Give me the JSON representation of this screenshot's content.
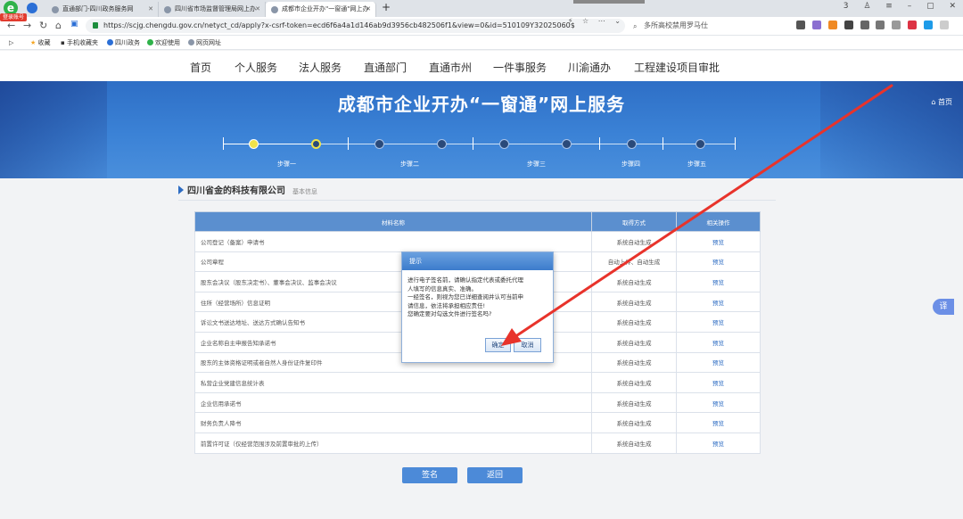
{
  "browser": {
    "login_badge": "登录账号",
    "tabs": [
      {
        "title": "直通部门-四川政务服务网"
      },
      {
        "title": "四川省市场监督管理局网上办"
      },
      {
        "title": "成都市企业开办\"一窗通\"网上办"
      }
    ],
    "url": "https://scjg.chengdu.gov.cn/netyct_cd/apply?x-csrf-token=ecd6f6a4a1d146ab9d3956cb482506f1&view=0&id=510109Y32025060$",
    "search_text": "多所高校禁用罗马仕",
    "page_counter": "3",
    "bookmarks": [
      {
        "label": "收藏"
      },
      {
        "label": "手机收藏夹"
      },
      {
        "label": "四川政务"
      },
      {
        "label": "欢迎使用"
      },
      {
        "label": "网页网址"
      }
    ]
  },
  "site_nav": [
    "首页",
    "个人服务",
    "法人服务",
    "直通部门",
    "直通市州",
    "一件事服务",
    "川渝通办",
    "工程建设项目审批"
  ],
  "banner": {
    "title": "成都市企业开办“一窗通”网上服务",
    "home": "首页",
    "steps": [
      "步骤一",
      "步骤二",
      "步骤三",
      "步骤四",
      "步骤五"
    ]
  },
  "section": {
    "company": "四川省金的科技有限公司",
    "sub": "基本信息"
  },
  "table": {
    "headers": [
      "材料名称",
      "取得方式",
      "相关操作"
    ],
    "rows": [
      {
        "name": "公司登记（备案）申请书",
        "method": "系统自动生成",
        "op": "预览"
      },
      {
        "name": "公司章程",
        "method": "自动上传、自动生成",
        "op": "预览"
      },
      {
        "name": "股东会决议（股东决定书）、董事会决议、监事会决议",
        "method": "系统自动生成",
        "op": "预览"
      },
      {
        "name": "住所（经营场所）信息证明",
        "method": "系统自动生成",
        "op": "预览"
      },
      {
        "name": "诉讼文书送达地址、送达方式确认告知书",
        "method": "系统自动生成",
        "op": "预览"
      },
      {
        "name": "企业名称自主申报告知承诺书",
        "method": "系统自动生成",
        "op": "预览"
      },
      {
        "name": "股东的主体资格证明或者自然人身份证件复印件",
        "method": "系统自动生成",
        "op": "预览"
      },
      {
        "name": "私营企业党建信息统计表",
        "method": "系统自动生成",
        "op": "预览"
      },
      {
        "name": "企业信用承诺书",
        "method": "系统自动生成",
        "op": "预览"
      },
      {
        "name": "财务负责人降书",
        "method": "系统自动生成",
        "op": "预览"
      },
      {
        "name": "前置许可证（仅经营范围涉及前置审批的上传）",
        "method": "系统自动生成",
        "op": "预览"
      }
    ]
  },
  "buttons": {
    "sign": "签名",
    "back": "返回"
  },
  "dialog": {
    "title": "提示",
    "lines": [
      "进行电子签名前，请确认指定代表或委托代理",
      "人填写的信息真实、准确。",
      "一经签名，则视为您已详细查阅并认可当前申",
      "请信息，依法将承担相应责任!",
      "您确定要对勾选文件进行签名吗?"
    ],
    "ok": "确定",
    "cancel": "取消"
  },
  "translate": "译",
  "colors": {
    "accent": "#4c8ad8",
    "arrow": "#e8332b"
  }
}
